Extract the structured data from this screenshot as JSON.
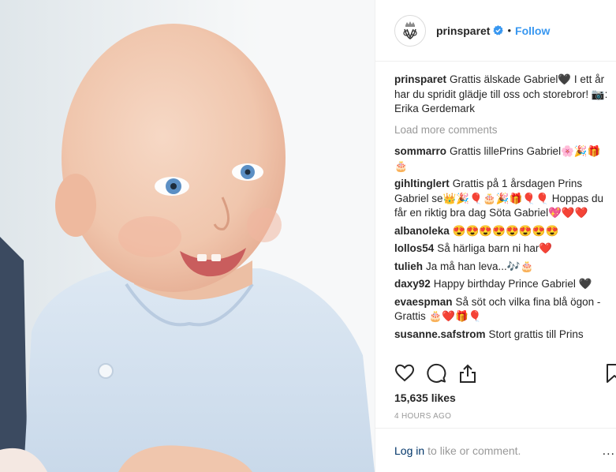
{
  "post": {
    "username": "prinsparet",
    "follow_label": "Follow",
    "dot": "•",
    "photo_alt": "Smiling baby in light blue shirt"
  },
  "caption": {
    "username": "prinsparet",
    "text": "Grattis älskade Gabriel🖤 I ett år har du spridit glädje till oss och storebror! 📷: Erika Gerdemark"
  },
  "load_more": "Load more comments",
  "comments": [
    {
      "user": "sommarro",
      "text": "Grattis lillePrins Gabriel🌸🎉🎁🎂"
    },
    {
      "user": "gihltinglert",
      "text": "Grattis på 1 årsdagen Prins Gabriel se👑🎉🎈🎂🎉🎁🎈🎈 Hoppas du får en riktig bra dag Söta Gabriel💖❤️❤️"
    },
    {
      "user": "albanoleka",
      "text": "😍😍😍😍😍😍😍😍"
    },
    {
      "user": "lollos54",
      "text": "Så härliga barn ni har❤️"
    },
    {
      "user": "tulieh",
      "text": "Ja må han leva...🎶🎂"
    },
    {
      "user": "daxy92",
      "text": "Happy birthday Prince Gabriel 🖤"
    },
    {
      "user": "evaespman",
      "text": "Så söt och vilka fina blå ögon - Grattis 🎂❤️🎁🎈"
    },
    {
      "user": "susanne.safstrom",
      "text": "Stort grattis till Prins"
    }
  ],
  "likes": "15,635 likes",
  "time": "4 HOURS AGO",
  "footer": {
    "login": "Log in",
    "text": "to like or comment.",
    "more": "..."
  },
  "icons": {
    "like": "heart-icon",
    "comment": "comment-icon",
    "share": "share-icon",
    "save": "bookmark-icon",
    "verified": "verified-badge-icon"
  },
  "colors": {
    "link_blue": "#3897f0",
    "login_blue": "#003569",
    "muted": "#999999",
    "text": "#262626"
  }
}
